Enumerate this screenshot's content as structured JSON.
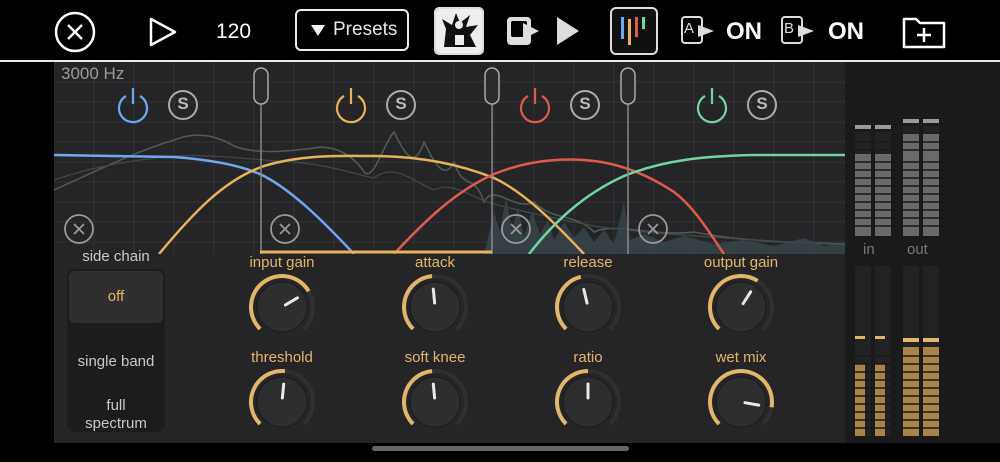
{
  "toolbar": {
    "close_icon": "close-circle-icon",
    "play_icon": "play-icon",
    "bpm": "120",
    "presets_label": "Presets",
    "thumbnail_icon": "ink-splash-thumbnail-icon",
    "export_icon": "export-play-icon",
    "meter_icon": "color-bars-icon",
    "a_label": "A",
    "a_state": "ON",
    "b_label": "B",
    "b_state": "ON",
    "folder_icon": "folder-add-icon"
  },
  "graph": {
    "freq_readout": "3000 Hz",
    "bands": [
      {
        "color": "#6fa8f0",
        "power_icon": "power-icon",
        "solo": "S"
      },
      {
        "color": "#e8b25c",
        "power_icon": "power-icon",
        "solo": "S"
      },
      {
        "color": "#e05a48",
        "power_icon": "power-icon",
        "solo": "S"
      },
      {
        "color": "#6fd6a2",
        "power_icon": "power-icon",
        "solo": "S"
      }
    ]
  },
  "sidechain": {
    "label": "side chain",
    "options": [
      "off",
      "single band",
      "full spectrum"
    ],
    "selected": "off"
  },
  "knobs": [
    {
      "label": "input gain",
      "value": 0.72
    },
    {
      "label": "attack",
      "value": 0.48
    },
    {
      "label": "release",
      "value": 0.45
    },
    {
      "label": "output gain",
      "value": 0.62
    },
    {
      "label": "threshold",
      "value": 0.52
    },
    {
      "label": "soft knee",
      "value": 0.48
    },
    {
      "label": "ratio",
      "value": 0.5
    },
    {
      "label": "wet mix",
      "value": 0.87
    }
  ],
  "meters": {
    "in_label": "in",
    "out_label": "out"
  },
  "colors": {
    "accent": "#e2b66a",
    "background": "#252527"
  }
}
